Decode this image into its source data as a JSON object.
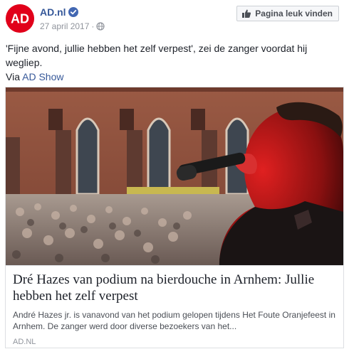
{
  "page": {
    "name": "AD.nl",
    "date": "27 april 2017",
    "dot": "·",
    "like_button": "Pagina leuk vinden",
    "avatar_text": "AD"
  },
  "post": {
    "text": "'Fijne avond, jullie hebben het zelf verpest', zei de zanger voordat hij wegliep.",
    "via_prefix": "Via",
    "via_link": "AD Show"
  },
  "link_card": {
    "title": "Dré Hazes van podium na bierdouche in Arnhem: Jullie hebben het zelf verpest",
    "description": "André Hazes jr. is vanavond van het podium gelopen tijdens Het Foute Oranjefeest in Arnhem. De zanger werd door diverse bezoekers van het...",
    "domain": "AD.nl"
  },
  "colors": {
    "brand_red": "#e1001a",
    "link_blue": "#365899",
    "verified_blue": "#4267b2"
  },
  "icons": [
    "verified-badge-icon",
    "globe-icon",
    "thumbs-up-icon"
  ]
}
